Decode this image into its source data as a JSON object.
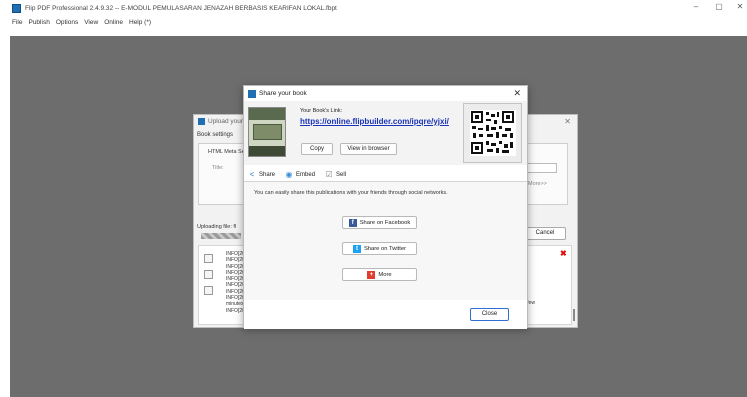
{
  "window": {
    "title": "Flip PDF Professional 2.4.9.32 -- E-MODUL PEMULASARAN JENAZAH BERBASIS KEARIFAN LOKAL.fbpt",
    "minimize": "–",
    "maximize": "▢",
    "close": "✕"
  },
  "menu": [
    "File",
    "Publish",
    "Options",
    "View",
    "Online",
    "Help (*)"
  ],
  "upload_dialog": {
    "title": "Upload your",
    "close": "✕",
    "book_settings": "Book settings",
    "html_meta": "HTML Meta Se",
    "title_label": "Title:",
    "more_label": "More>>",
    "uploading_label": "Uploading file: fl",
    "cancel_label": "Cancel",
    "log_lines": [
      "INFO[20",
      "INFO[20",
      "INFO[20",
      "INFO[20",
      "INFO[20",
      "INFO[20",
      "INFO[20",
      "INFO[20",
      "minutes",
      "INFO[20"
    ],
    "few_text": "a few"
  },
  "share_dialog": {
    "title": "Share your book",
    "close": "✕",
    "link_label": "Your Book's Link:",
    "link": "https://online.flipbuilder.com/ipqre/yjxi/",
    "copy_label": "Copy",
    "view_label": "View in browser",
    "tabs": [
      {
        "label": "Share",
        "icon": "share-icon",
        "color": "#2d79c7"
      },
      {
        "label": "Embed",
        "icon": "globe-icon",
        "color": "#3b8ed8"
      },
      {
        "label": "Sell",
        "icon": "checkbox-icon",
        "color": "#888888"
      }
    ],
    "description": "You can easily share this publications with your friends through social networks.",
    "facebook_label": "Share on Facebook",
    "twitter_label": "Share on Twitter",
    "more_label": "More",
    "close_button": "Close"
  },
  "colors": {
    "workspace": "#6d6d6d",
    "link": "#1a33b7",
    "facebook": "#3b5998",
    "twitter": "#1da1f2",
    "more": "#e03b2b",
    "accent": "#2f6fd1"
  }
}
